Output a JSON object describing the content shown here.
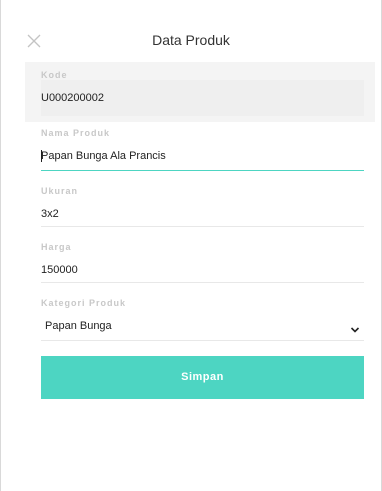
{
  "header": {
    "title": "Data Produk",
    "close_icon": "close-icon"
  },
  "form": {
    "kode": {
      "label": "Kode",
      "value": "U000200002"
    },
    "nama_produk": {
      "label": "Nama Produk",
      "value": "Papan Bunga Ala Prancis"
    },
    "ukuran": {
      "label": "Ukuran",
      "value": "3x2"
    },
    "harga": {
      "label": "Harga",
      "value": "150000"
    },
    "kategori_produk": {
      "label": "Kategori Produk",
      "value": "Papan Bunga",
      "icon": "chevron-down-icon"
    }
  },
  "actions": {
    "save_label": "Simpan"
  },
  "colors": {
    "accent": "#4dd5c2",
    "label": "#c8c8c8",
    "readonly_bg": "#efefef"
  }
}
